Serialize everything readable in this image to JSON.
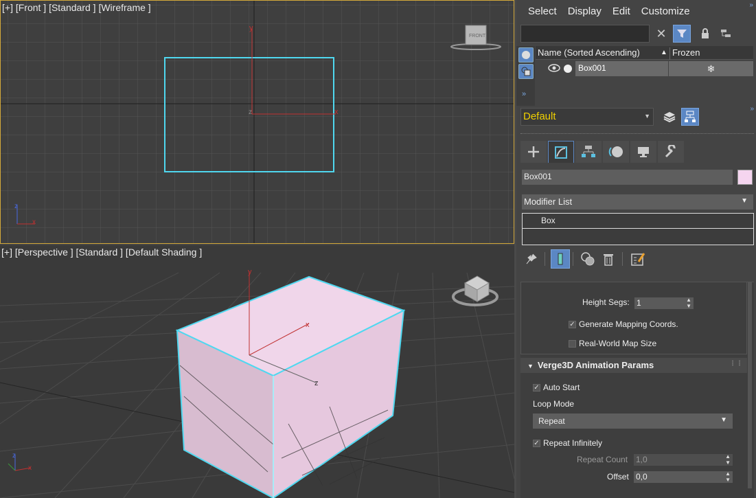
{
  "front_viewport": {
    "label": "[+] [Front ] [Standard ] [Wireframe ]",
    "axis_y": "y",
    "axis_z": "z",
    "axis_x": "x",
    "cube_label": "FRONT"
  },
  "persp_viewport": {
    "label": "[+] [Perspective ] [Standard ] [Default Shading ]",
    "axis_y": "y",
    "axis_x": "x",
    "axis_z": "z"
  },
  "menu": {
    "items": [
      "Select",
      "Display",
      "Edit",
      "Customize"
    ]
  },
  "scene_explorer": {
    "search_placeholder": "",
    "col_name": "Name (Sorted Ascending)",
    "col_frozen": "Frozen",
    "sort_arrow": "▲",
    "row_name": "Box001",
    "row_frozen_icon": "❄"
  },
  "layer": {
    "current": "Default"
  },
  "command_panel": {
    "object_name": "Box001",
    "object_color": "#f5d5ef",
    "modifier_list_label": "Modifier List",
    "stack_items": [
      "Box"
    ]
  },
  "params": {
    "height_segs_label": "Height Segs:",
    "height_segs_value": "1",
    "gen_mapping_label": "Generate Mapping Coords.",
    "gen_mapping_checked": true,
    "real_world_label": "Real-World Map Size",
    "real_world_checked": false
  },
  "verge3d": {
    "title": "Verge3D Animation Params",
    "auto_start_label": "Auto Start",
    "loop_mode_label": "Loop Mode",
    "loop_mode_value": "Repeat",
    "repeat_inf_label": "Repeat Infinitely",
    "repeat_count_label": "Repeat Count",
    "repeat_count_value": "1,0",
    "offset_label": "Offset",
    "offset_value": "0,0"
  },
  "colors": {
    "accent": "#5b87c4",
    "selection": "#4fd8f0",
    "layer_text": "#f0d000",
    "box_fill": "#f0d0e8"
  }
}
